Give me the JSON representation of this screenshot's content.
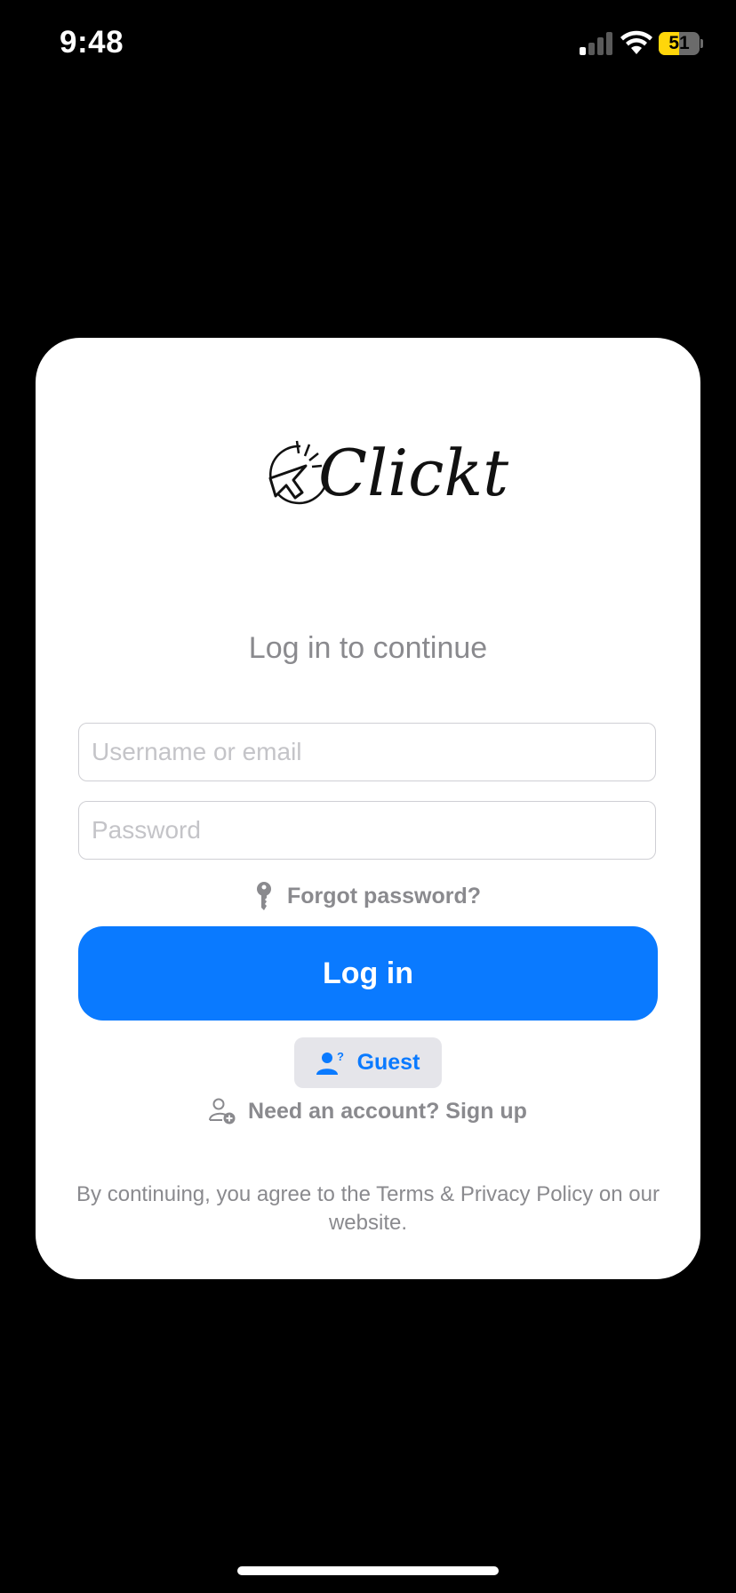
{
  "status_bar": {
    "time": "9:48",
    "battery_percent": 51,
    "battery_label": "51",
    "signal_bars_active": 1,
    "signal_bars_total": 4
  },
  "logo": {
    "text": "Clickt",
    "icon": "cursor-click-icon"
  },
  "login": {
    "subtitle": "Log in to continue",
    "username_placeholder": "Username or email",
    "password_placeholder": "Password",
    "forgot_password": "Forgot password?",
    "login_button": "Log in",
    "guest_button": "Guest",
    "signup_link": "Need an account? Sign up",
    "footer": "By continuing, you agree to the Terms & Privacy Policy on our website."
  },
  "colors": {
    "accent": "#0a7aff",
    "muted_text": "#8a8a8e",
    "background": "#000000",
    "card": "#ffffff",
    "battery": "#ffd60a"
  }
}
